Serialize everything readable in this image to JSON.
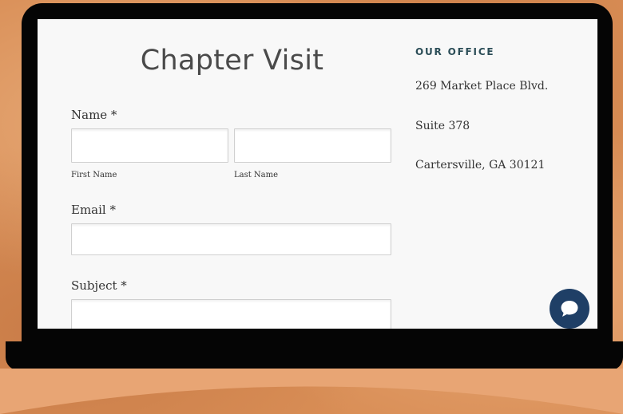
{
  "form": {
    "title": "Chapter Visit",
    "name_label": "Name *",
    "first_name_label": "First Name",
    "last_name_label": "Last Name",
    "email_label": "Email *",
    "subject_label": "Subject *",
    "first_name_value": "",
    "last_name_value": "",
    "email_value": "",
    "subject_value": ""
  },
  "office": {
    "heading": "OUR OFFICE",
    "address_line1": "269 Market Place Blvd.",
    "address_line2": "Suite 378",
    "address_line3": "Cartersville, GA 30121"
  },
  "chat": {
    "icon": "chat-bubble-icon",
    "color": "#1f3f66"
  },
  "colors": {
    "background": "#d98e56",
    "office_heading": "#2b4d57"
  }
}
